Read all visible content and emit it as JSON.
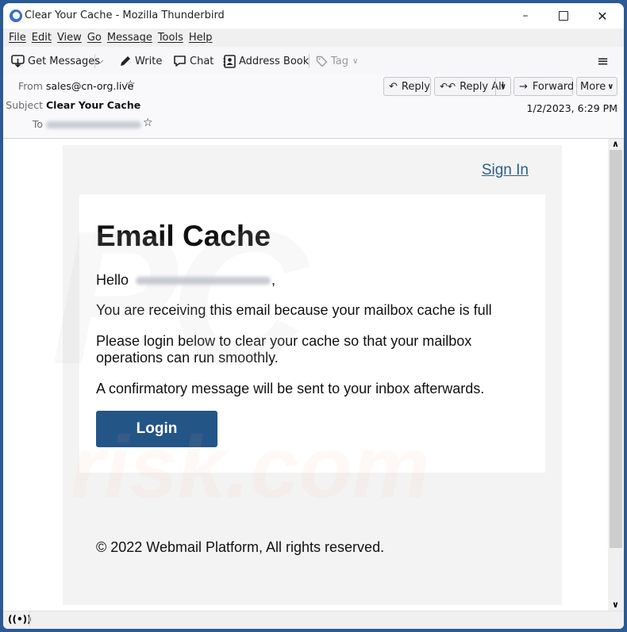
{
  "window": {
    "title": "Clear Your Cache - Mozilla Thunderbird",
    "minimize_icon": "minimize-icon",
    "maximize_icon": "maximize-icon",
    "close_icon": "close-icon"
  },
  "menu": [
    "File",
    "Edit",
    "View",
    "Go",
    "Message",
    "Tools",
    "Help"
  ],
  "toolbar": {
    "get_messages": "Get Messages",
    "write": "Write",
    "chat": "Chat",
    "address_book": "Address Book",
    "tag": "Tag"
  },
  "header": {
    "from_label": "From",
    "from_value": "sales@cn-org.live",
    "subject_label": "Subject",
    "subject_value": "Clear Your Cache",
    "to_label": "To",
    "to_value_blurred": true,
    "date": "1/2/2023, 6:29 PM",
    "buttons": {
      "reply": "Reply",
      "reply_all": "Reply All",
      "forward": "Forward",
      "more": "More"
    }
  },
  "email": {
    "sign_in": "Sign In",
    "heading": "Email Cache",
    "hello": "Hello",
    "hello_suffix": ",",
    "p1": "You are receiving this email because your mailbox cache is full",
    "p2": "Please login below to clear your cache so that your mailbox operations can run smoothly.",
    "p3": "A confirmatory message will be sent to your inbox afterwards.",
    "login": "Login",
    "footer": "© 2022 Webmail Platform, All rights reserved.",
    "button_color": "#245587",
    "link_color": "#2c5d8a"
  },
  "watermark": {
    "line1": "PC",
    "line2": "risk.com"
  }
}
